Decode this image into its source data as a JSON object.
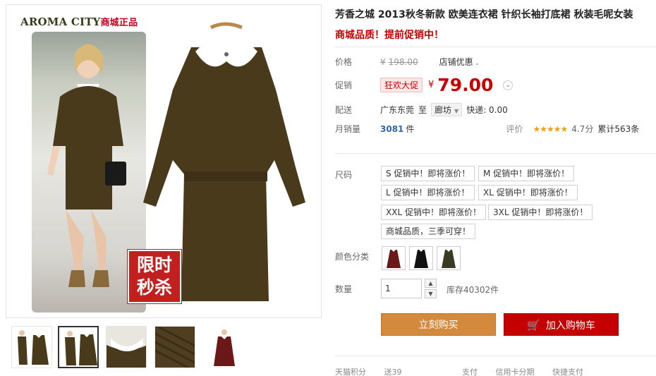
{
  "brand": {
    "name_en": "AROMA CITY",
    "name_cn": "商城正品"
  },
  "flash_badge": {
    "line1": "限时",
    "line2": "秒杀"
  },
  "product": {
    "title": "芳香之城 2013秋冬新款 欧美连衣裙 针织长袖打底裙 秋装毛呢女装",
    "subtitle": "商城品质！提前促销中！"
  },
  "price_row": {
    "label": "价格",
    "currency": "¥",
    "original": "198.00",
    "store_discount": "店铺优惠"
  },
  "promo_row": {
    "label": "促销",
    "tag": "狂欢大促",
    "currency": "¥",
    "price": "79.00"
  },
  "ship_row": {
    "label": "配送",
    "from": "广东东莞",
    "to_word": "至",
    "city": "廊坊",
    "express": "快递: 0.00"
  },
  "sales_row": {
    "label": "月销量",
    "count": "3081",
    "unit": "件",
    "rate_label": "评价",
    "stars": "★★★★★",
    "score": "4.7分",
    "reviews": "累计563条"
  },
  "size": {
    "label": "尺码",
    "options": [
      "S 促销中！即将涨价！",
      "M 促销中！即将涨价！",
      "L 促销中！即将涨价！",
      "XL 促销中！即将涨价！",
      "XXL 促销中！即将涨价！",
      "3XL 促销中！即将涨价！",
      "商城品质，三季可穿！"
    ]
  },
  "color": {
    "label": "颜色分类",
    "swatches": [
      "wine-red-dress",
      "black-dress",
      "army-green-dress"
    ]
  },
  "quantity": {
    "label": "数量",
    "value": "1",
    "stock": "库存40302件"
  },
  "actions": {
    "buy": "立刻购买",
    "cart": "加入购物车"
  },
  "footer": {
    "points_label": "天猫积分",
    "points_value": "送39",
    "pay_label": "支付",
    "installment": "信用卡分期",
    "quick_pay": "快捷支付"
  },
  "colors": {
    "accent_red": "#c40000",
    "buy_orange": "#d48a3c",
    "dress_brown": "#4a3a1c"
  }
}
